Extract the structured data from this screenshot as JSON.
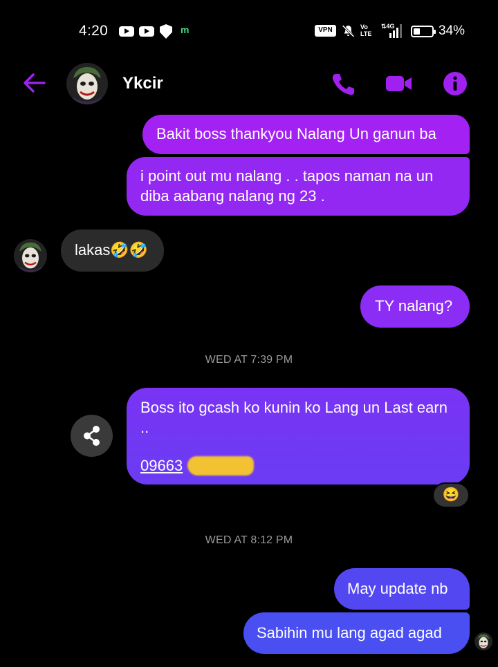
{
  "status_bar": {
    "time": "4:20",
    "vpn_label": "VPN",
    "volte_label": "Vo\nLTE",
    "network": "4G",
    "battery_pct": "34%",
    "icons": [
      "youtube-icon",
      "youtube-icon",
      "shield-icon",
      "messenger-m-icon",
      "vpn-icon",
      "mute-bell-icon",
      "volte-icon",
      "signal-icon",
      "battery-icon"
    ]
  },
  "header": {
    "contact_name": "Ykcir",
    "accent_color": "#a020f0",
    "icons": [
      "back-arrow-icon",
      "phone-icon",
      "video-camera-icon",
      "info-icon"
    ]
  },
  "messages": [
    {
      "direction": "outgoing",
      "text": "Bakit boss thankyou Nalang Un ganun ba"
    },
    {
      "direction": "outgoing",
      "text": "i point out mu nalang . . tapos naman na un diba aabang nalang ng 23 ."
    },
    {
      "direction": "incoming",
      "text": "lakas🤣🤣"
    },
    {
      "direction": "outgoing",
      "text": "TY nalang?"
    },
    {
      "direction": "outgoing",
      "text": "Boss ito gcash ko kunin ko Lang un Last earn ..",
      "link": "09663",
      "reaction": "😆"
    },
    {
      "direction": "outgoing",
      "text": "May update nb"
    },
    {
      "direction": "outgoing",
      "text": "Sabihin mu lang agad agad"
    }
  ],
  "timestamps": [
    "WED AT 7:39 PM",
    "WED AT 8:12 PM"
  ]
}
